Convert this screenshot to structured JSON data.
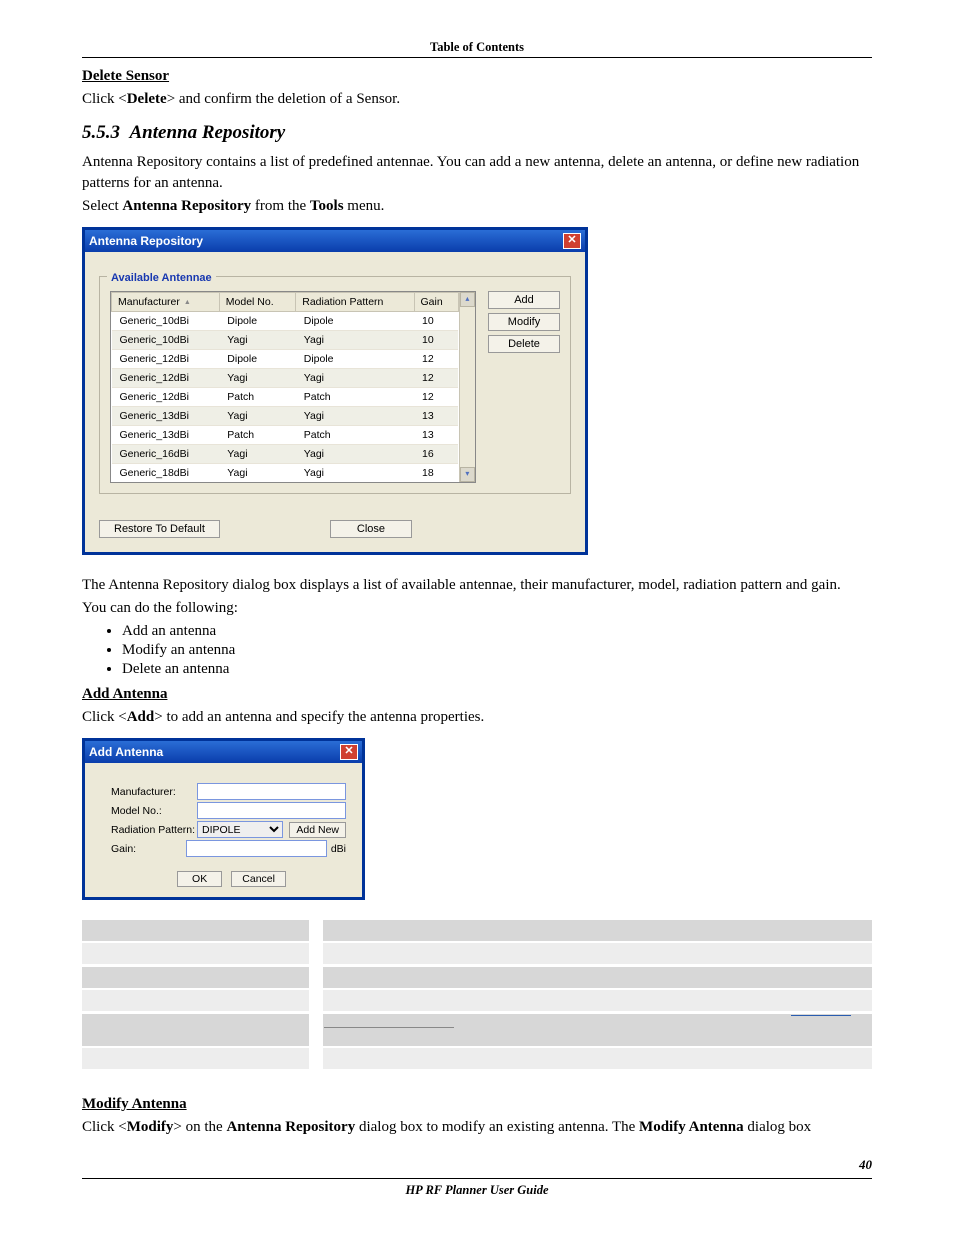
{
  "header": {
    "toc": "Table of Contents"
  },
  "sec_delete_sensor": {
    "title": "Delete Sensor",
    "text_pre": "Click <",
    "text_bold": "Delete",
    "text_post": "> and confirm the deletion of a Sensor."
  },
  "sec_repo": {
    "num": "5.5.3",
    "title": "Antenna Repository",
    "p1": "Antenna Repository contains a list of predefined antennae. You can add a new antenna, delete an antenna, or define new radiation patterns for an antenna.",
    "p2a": "Select ",
    "p2b": "Antenna Repository",
    "p2c": " from the ",
    "p2d": "Tools",
    "p2e": " menu.",
    "after_img_p": "The Antenna Repository dialog box displays a list of available antennae, their manufacturer, model, radiation pattern and gain.",
    "after_img_p2": "You can do the following:",
    "bullets": [
      "Add an antenna",
      "Modify an antenna",
      "Delete an antenna"
    ]
  },
  "repo_dialog": {
    "title": "Antenna Repository",
    "group_label": "Available Antennae",
    "columns": [
      "Manufacturer",
      "Model No.",
      "Radiation Pattern",
      "Gain"
    ],
    "rows": [
      {
        "mfr": "Generic_10dBi",
        "model": "Dipole",
        "pattern": "Dipole",
        "gain": "10",
        "alt": false
      },
      {
        "mfr": "Generic_10dBi",
        "model": "Yagi",
        "pattern": "Yagi",
        "gain": "10",
        "alt": true
      },
      {
        "mfr": "Generic_12dBi",
        "model": "Dipole",
        "pattern": "Dipole",
        "gain": "12",
        "alt": false
      },
      {
        "mfr": "Generic_12dBi",
        "model": "Yagi",
        "pattern": "Yagi",
        "gain": "12",
        "alt": true
      },
      {
        "mfr": "Generic_12dBi",
        "model": "Patch",
        "pattern": "Patch",
        "gain": "12",
        "alt": false
      },
      {
        "mfr": "Generic_13dBi",
        "model": "Yagi",
        "pattern": "Yagi",
        "gain": "13",
        "alt": true
      },
      {
        "mfr": "Generic_13dBi",
        "model": "Patch",
        "pattern": "Patch",
        "gain": "13",
        "alt": false
      },
      {
        "mfr": "Generic_16dBi",
        "model": "Yagi",
        "pattern": "Yagi",
        "gain": "16",
        "alt": true
      },
      {
        "mfr": "Generic_18dBi",
        "model": "Yagi",
        "pattern": "Yagi",
        "gain": "18",
        "alt": false
      }
    ],
    "buttons": {
      "add": "Add",
      "modify": "Modify",
      "delete": "Delete",
      "restore": "Restore To Default",
      "close": "Close"
    }
  },
  "sec_add": {
    "title": "Add Antenna",
    "text_pre": "Click <",
    "text_bold": "Add",
    "text_post": "> to add an antenna and specify the antenna properties."
  },
  "add_dialog": {
    "title": "Add Antenna",
    "labels": {
      "mfr": "Manufacturer:",
      "model": "Model No.:",
      "pattern": "Radiation Pattern:",
      "gain": "Gain:"
    },
    "pattern_value": "DIPOLE",
    "unit": "dBi",
    "addnew": "Add New",
    "ok": "OK",
    "cancel": "Cancel"
  },
  "sec_modify": {
    "title": "Modify Antenna",
    "t1": "Click <",
    "t2": "Modify",
    "t3": "> on the ",
    "t4": "Antenna Repository",
    "t5": " dialog box to modify an existing antenna. The ",
    "t6": "Modify Antenna",
    "t7": " dialog box"
  },
  "footer": {
    "text": "HP RF Planner User Guide",
    "page": "40"
  }
}
